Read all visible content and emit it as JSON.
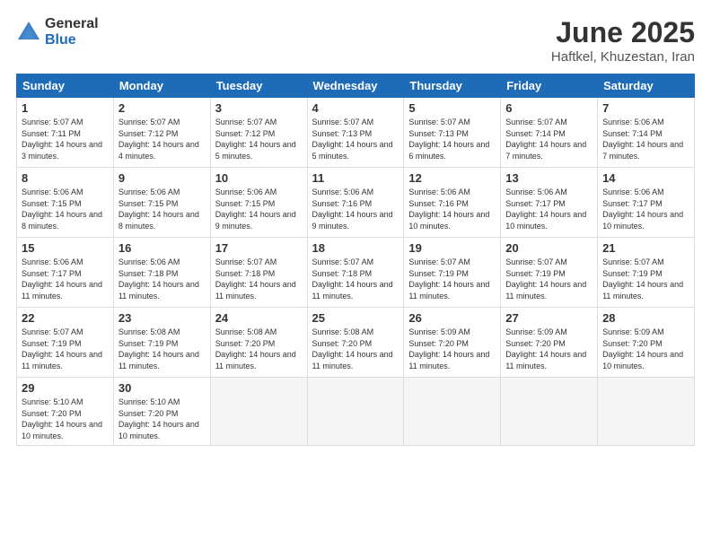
{
  "logo": {
    "general": "General",
    "blue": "Blue"
  },
  "title": "June 2025",
  "location": "Haftkel, Khuzestan, Iran",
  "weekdays": [
    "Sunday",
    "Monday",
    "Tuesday",
    "Wednesday",
    "Thursday",
    "Friday",
    "Saturday"
  ],
  "weeks": [
    [
      {
        "day": "1",
        "sunrise": "Sunrise: 5:07 AM",
        "sunset": "Sunset: 7:11 PM",
        "daylight": "Daylight: 14 hours and 3 minutes."
      },
      {
        "day": "2",
        "sunrise": "Sunrise: 5:07 AM",
        "sunset": "Sunset: 7:12 PM",
        "daylight": "Daylight: 14 hours and 4 minutes."
      },
      {
        "day": "3",
        "sunrise": "Sunrise: 5:07 AM",
        "sunset": "Sunset: 7:12 PM",
        "daylight": "Daylight: 14 hours and 5 minutes."
      },
      {
        "day": "4",
        "sunrise": "Sunrise: 5:07 AM",
        "sunset": "Sunset: 7:13 PM",
        "daylight": "Daylight: 14 hours and 5 minutes."
      },
      {
        "day": "5",
        "sunrise": "Sunrise: 5:07 AM",
        "sunset": "Sunset: 7:13 PM",
        "daylight": "Daylight: 14 hours and 6 minutes."
      },
      {
        "day": "6",
        "sunrise": "Sunrise: 5:07 AM",
        "sunset": "Sunset: 7:14 PM",
        "daylight": "Daylight: 14 hours and 7 minutes."
      },
      {
        "day": "7",
        "sunrise": "Sunrise: 5:06 AM",
        "sunset": "Sunset: 7:14 PM",
        "daylight": "Daylight: 14 hours and 7 minutes."
      }
    ],
    [
      {
        "day": "8",
        "sunrise": "Sunrise: 5:06 AM",
        "sunset": "Sunset: 7:15 PM",
        "daylight": "Daylight: 14 hours and 8 minutes."
      },
      {
        "day": "9",
        "sunrise": "Sunrise: 5:06 AM",
        "sunset": "Sunset: 7:15 PM",
        "daylight": "Daylight: 14 hours and 8 minutes."
      },
      {
        "day": "10",
        "sunrise": "Sunrise: 5:06 AM",
        "sunset": "Sunset: 7:15 PM",
        "daylight": "Daylight: 14 hours and 9 minutes."
      },
      {
        "day": "11",
        "sunrise": "Sunrise: 5:06 AM",
        "sunset": "Sunset: 7:16 PM",
        "daylight": "Daylight: 14 hours and 9 minutes."
      },
      {
        "day": "12",
        "sunrise": "Sunrise: 5:06 AM",
        "sunset": "Sunset: 7:16 PM",
        "daylight": "Daylight: 14 hours and 10 minutes."
      },
      {
        "day": "13",
        "sunrise": "Sunrise: 5:06 AM",
        "sunset": "Sunset: 7:17 PM",
        "daylight": "Daylight: 14 hours and 10 minutes."
      },
      {
        "day": "14",
        "sunrise": "Sunrise: 5:06 AM",
        "sunset": "Sunset: 7:17 PM",
        "daylight": "Daylight: 14 hours and 10 minutes."
      }
    ],
    [
      {
        "day": "15",
        "sunrise": "Sunrise: 5:06 AM",
        "sunset": "Sunset: 7:17 PM",
        "daylight": "Daylight: 14 hours and 11 minutes."
      },
      {
        "day": "16",
        "sunrise": "Sunrise: 5:06 AM",
        "sunset": "Sunset: 7:18 PM",
        "daylight": "Daylight: 14 hours and 11 minutes."
      },
      {
        "day": "17",
        "sunrise": "Sunrise: 5:07 AM",
        "sunset": "Sunset: 7:18 PM",
        "daylight": "Daylight: 14 hours and 11 minutes."
      },
      {
        "day": "18",
        "sunrise": "Sunrise: 5:07 AM",
        "sunset": "Sunset: 7:18 PM",
        "daylight": "Daylight: 14 hours and 11 minutes."
      },
      {
        "day": "19",
        "sunrise": "Sunrise: 5:07 AM",
        "sunset": "Sunset: 7:19 PM",
        "daylight": "Daylight: 14 hours and 11 minutes."
      },
      {
        "day": "20",
        "sunrise": "Sunrise: 5:07 AM",
        "sunset": "Sunset: 7:19 PM",
        "daylight": "Daylight: 14 hours and 11 minutes."
      },
      {
        "day": "21",
        "sunrise": "Sunrise: 5:07 AM",
        "sunset": "Sunset: 7:19 PM",
        "daylight": "Daylight: 14 hours and 11 minutes."
      }
    ],
    [
      {
        "day": "22",
        "sunrise": "Sunrise: 5:07 AM",
        "sunset": "Sunset: 7:19 PM",
        "daylight": "Daylight: 14 hours and 11 minutes."
      },
      {
        "day": "23",
        "sunrise": "Sunrise: 5:08 AM",
        "sunset": "Sunset: 7:19 PM",
        "daylight": "Daylight: 14 hours and 11 minutes."
      },
      {
        "day": "24",
        "sunrise": "Sunrise: 5:08 AM",
        "sunset": "Sunset: 7:20 PM",
        "daylight": "Daylight: 14 hours and 11 minutes."
      },
      {
        "day": "25",
        "sunrise": "Sunrise: 5:08 AM",
        "sunset": "Sunset: 7:20 PM",
        "daylight": "Daylight: 14 hours and 11 minutes."
      },
      {
        "day": "26",
        "sunrise": "Sunrise: 5:09 AM",
        "sunset": "Sunset: 7:20 PM",
        "daylight": "Daylight: 14 hours and 11 minutes."
      },
      {
        "day": "27",
        "sunrise": "Sunrise: 5:09 AM",
        "sunset": "Sunset: 7:20 PM",
        "daylight": "Daylight: 14 hours and 11 minutes."
      },
      {
        "day": "28",
        "sunrise": "Sunrise: 5:09 AM",
        "sunset": "Sunset: 7:20 PM",
        "daylight": "Daylight: 14 hours and 10 minutes."
      }
    ],
    [
      {
        "day": "29",
        "sunrise": "Sunrise: 5:10 AM",
        "sunset": "Sunset: 7:20 PM",
        "daylight": "Daylight: 14 hours and 10 minutes."
      },
      {
        "day": "30",
        "sunrise": "Sunrise: 5:10 AM",
        "sunset": "Sunset: 7:20 PM",
        "daylight": "Daylight: 14 hours and 10 minutes."
      },
      null,
      null,
      null,
      null,
      null
    ]
  ]
}
